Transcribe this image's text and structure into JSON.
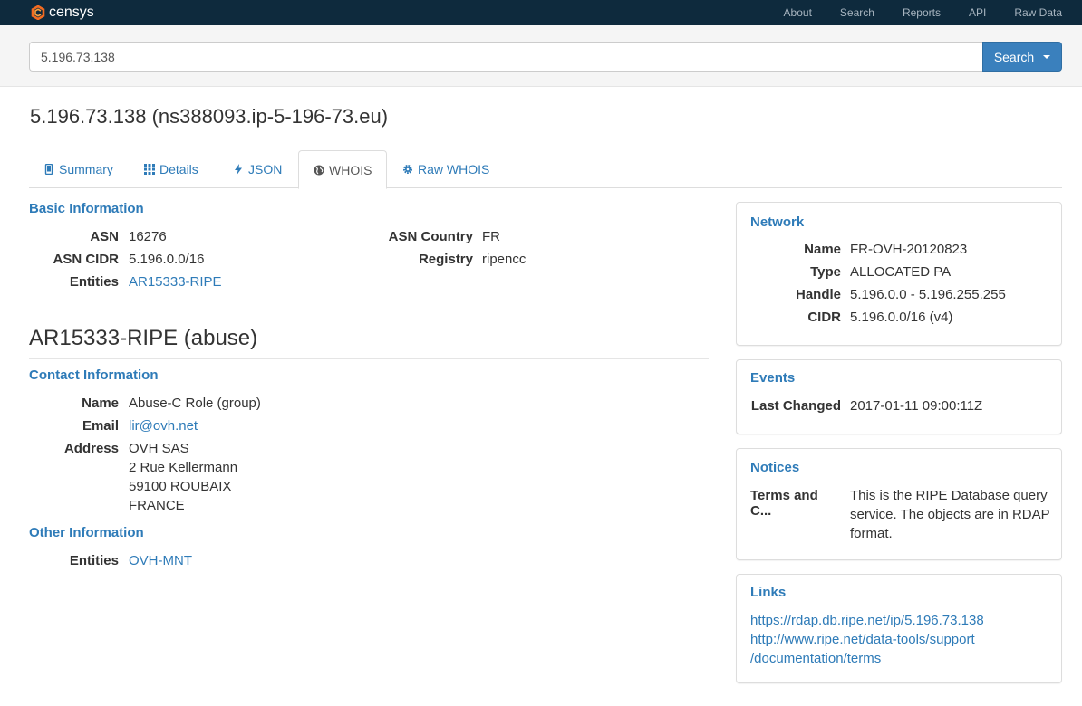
{
  "nav": {
    "logo_text": "censys",
    "links": [
      "About",
      "Search",
      "Reports",
      "API",
      "Raw Data"
    ]
  },
  "search": {
    "value": "5.196.73.138",
    "button_label": "Search"
  },
  "page_title": "5.196.73.138 (ns388093.ip-5-196-73.eu)",
  "tabs": [
    {
      "label": "Summary",
      "icon": "mobile-icon"
    },
    {
      "label": "Details",
      "icon": "grid-icon"
    },
    {
      "label": "JSON",
      "icon": "bolt-icon"
    },
    {
      "label": "WHOIS",
      "icon": "globe-icon",
      "active": true
    },
    {
      "label": "Raw WHOIS",
      "icon": "gear-icon"
    }
  ],
  "basic_info": {
    "heading": "Basic Information",
    "asn_label": "ASN",
    "asn": "16276",
    "asn_cidr_label": "ASN CIDR",
    "asn_cidr": "5.196.0.0/16",
    "entities_label": "Entities",
    "entities": "AR15333-RIPE",
    "asn_country_label": "ASN Country",
    "asn_country": "FR",
    "registry_label": "Registry",
    "registry": "ripencc"
  },
  "entity": {
    "title": "AR15333-RIPE (abuse)",
    "contact_heading": "Contact Information",
    "name_label": "Name",
    "name": "Abuse-C Role (group)",
    "email_label": "Email",
    "email": "lir@ovh.net",
    "address_label": "Address",
    "address": [
      "OVH SAS",
      "2 Rue Kellermann",
      "59100 ROUBAIX",
      "FRANCE"
    ],
    "other_heading": "Other Information",
    "other_entities_label": "Entities",
    "other_entities": "OVH-MNT"
  },
  "network": {
    "heading": "Network",
    "name_label": "Name",
    "name": "FR-OVH-20120823",
    "type_label": "Type",
    "type": "ALLOCATED PA",
    "handle_label": "Handle",
    "handle": "5.196.0.0 - 5.196.255.255",
    "cidr_label": "CIDR",
    "cidr": "5.196.0.0/16 (v4)"
  },
  "events": {
    "heading": "Events",
    "last_changed_label": "Last Changed",
    "last_changed": "2017-01-11 09:00:11Z"
  },
  "notices": {
    "heading": "Notices",
    "terms_label": "Terms and C...",
    "terms_lines": [
      "This is the RIPE Database query",
      "service. The objects are in RDAP",
      "format."
    ]
  },
  "links": {
    "heading": "Links",
    "link1": "https://rdap.db.ripe.net/ip/5.196.73.138",
    "link2_lines": [
      "http://www.ripe.net/data-tools/support",
      "/documentation/terms"
    ]
  },
  "colors": {
    "navbar": "#0e2a3d",
    "accent": "#2e7bb8",
    "button": "#3a80bd"
  }
}
